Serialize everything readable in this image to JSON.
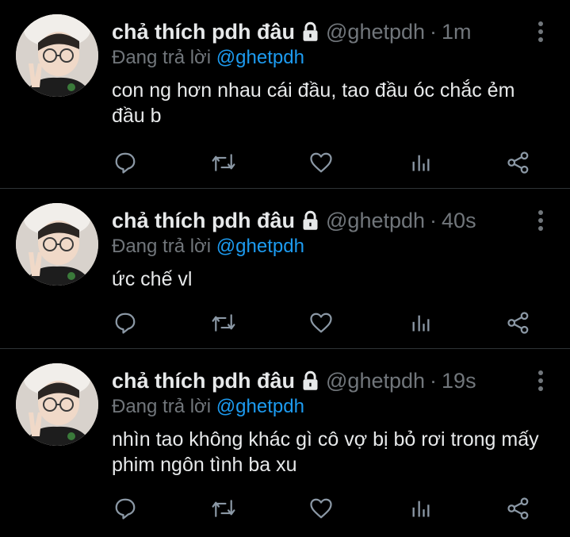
{
  "colors": {
    "background": "#000000",
    "text_primary": "#e7e9ea",
    "text_secondary": "#71767b",
    "accent": "#1d9bf0",
    "divider": "#2f3336",
    "icon": "#8b98a5"
  },
  "tweets": [
    {
      "display_name": "chả thích pdh đâu",
      "handle": "@ghetpdh",
      "separator": "·",
      "time": "1m",
      "reply_prefix": "Đang trả lời",
      "reply_to": "@ghetpdh",
      "text": "con ng hơn nhau cái đầu, tao đầu óc chắc ẻm đầu b",
      "icons": [
        "lock-icon",
        "more-icon",
        "reply-icon",
        "retweet-icon",
        "like-icon",
        "stats-icon",
        "share-icon"
      ]
    },
    {
      "display_name": "chả thích pdh đâu",
      "handle": "@ghetpdh",
      "separator": "·",
      "time": "40s",
      "reply_prefix": "Đang trả lời",
      "reply_to": "@ghetpdh",
      "text": "ức chế vl",
      "icons": [
        "lock-icon",
        "more-icon",
        "reply-icon",
        "retweet-icon",
        "like-icon",
        "stats-icon",
        "share-icon"
      ]
    },
    {
      "display_name": "chả thích pdh đâu",
      "handle": "@ghetpdh",
      "separator": "·",
      "time": "19s",
      "reply_prefix": "Đang trả lời",
      "reply_to": "@ghetpdh",
      "text": "nhìn tao không khác gì cô vợ bị bỏ rơi trong mấy phim ngôn tình ba xu",
      "icons": [
        "lock-icon",
        "more-icon",
        "reply-icon",
        "retweet-icon",
        "like-icon",
        "stats-icon",
        "share-icon"
      ]
    }
  ]
}
